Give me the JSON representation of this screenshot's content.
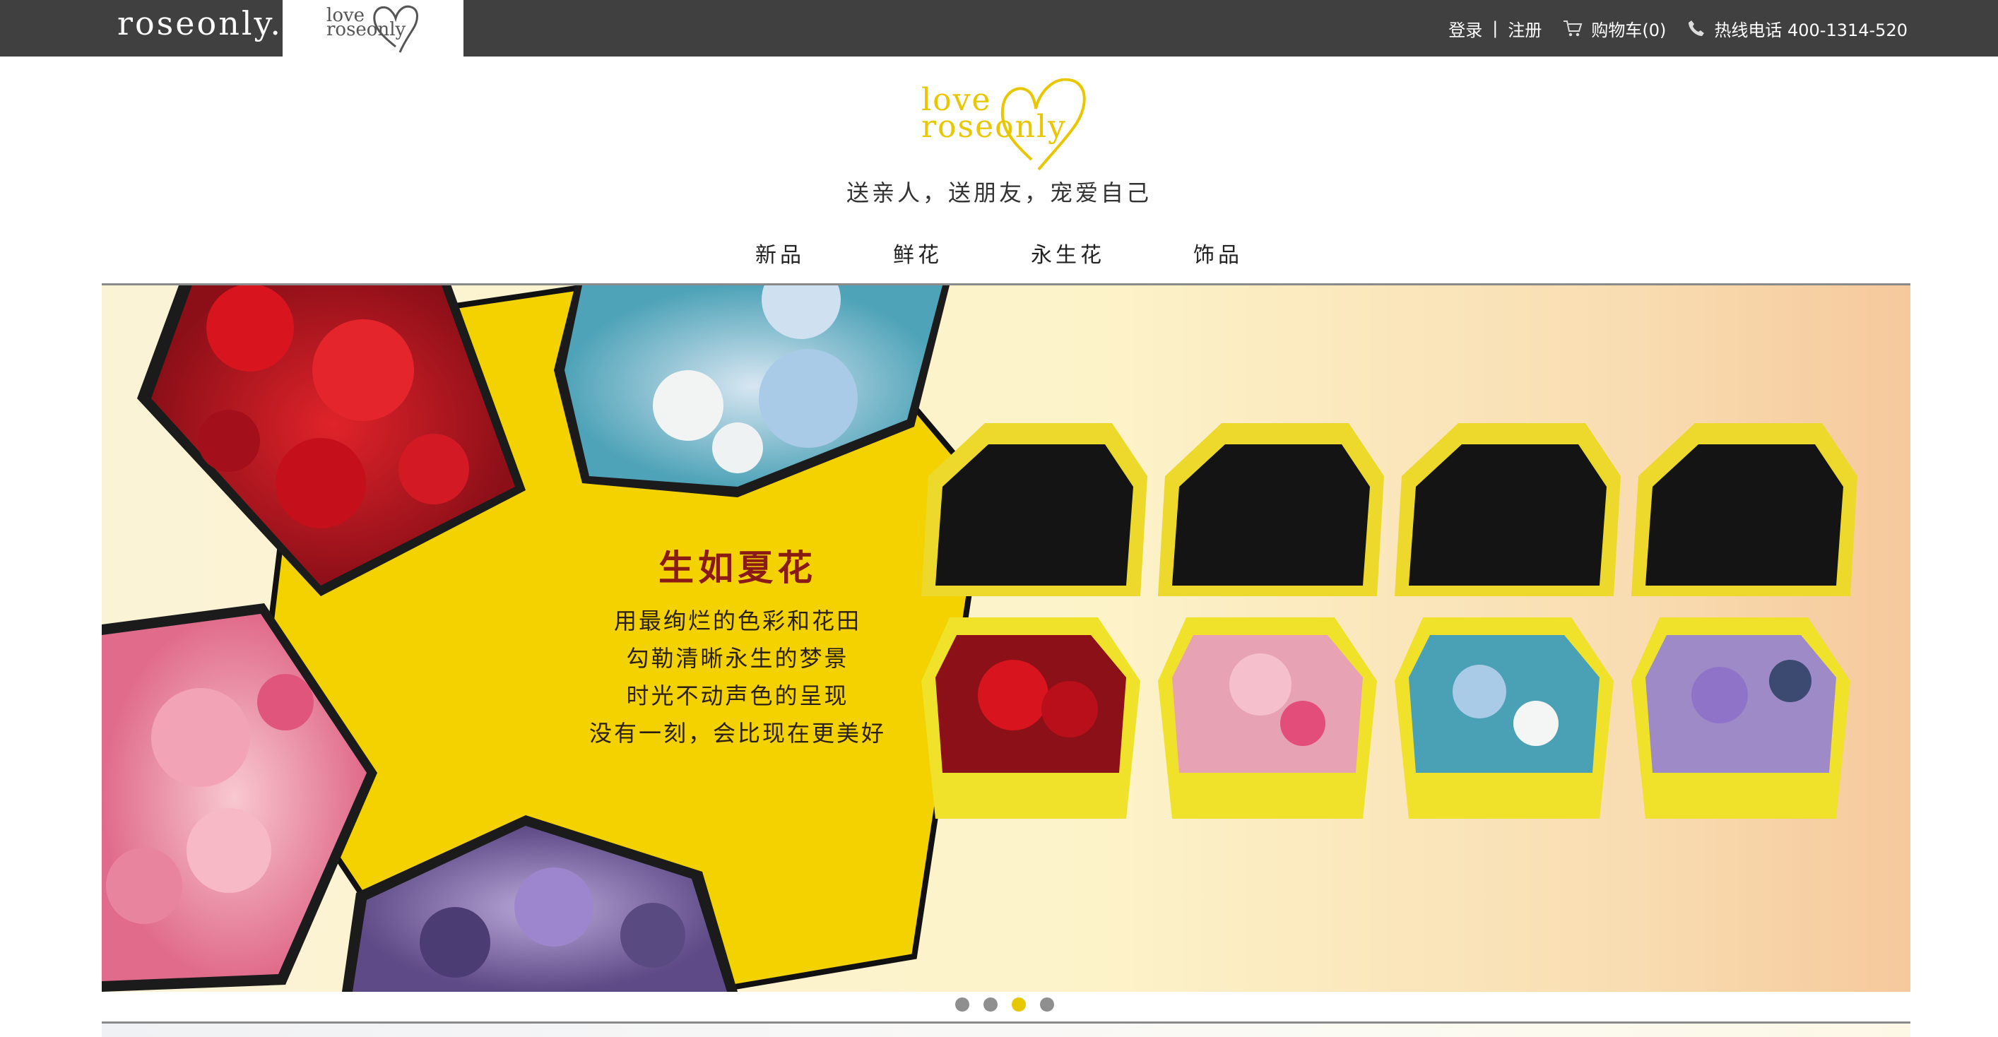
{
  "topbar": {
    "brand_tab": "roseonly.",
    "love_tab_line1": "love",
    "love_tab_line2": "roseonly",
    "login": "登录",
    "separator": "|",
    "register": "注册",
    "cart": "购物车(0)",
    "hotline": "热线电话 400-1314-520",
    "cart_icon": "cart-icon",
    "phone_icon": "phone-icon"
  },
  "logo": {
    "line1": "love",
    "line2": "roseonly",
    "tagline": "送亲人，送朋友，宠爱自己"
  },
  "nav": {
    "items": [
      "新品",
      "鲜花",
      "永生花",
      "饰品"
    ]
  },
  "hero": {
    "title": "生如夏花",
    "lines": [
      "用最绚烂的色彩和花田",
      "勾勒清晰永生的梦景",
      "时光不动声色的呈现",
      "没有一刻，会比现在更美好"
    ],
    "accent_yellow": "#f3d200",
    "box_yellow": "#f0e12a"
  },
  "carousel": {
    "count": 4,
    "active_index": 2
  },
  "colors": {
    "topbar_bg": "#404040",
    "logo_gold": "#e8c600",
    "hero_title": "#8a1a14",
    "dot_active": "#e6c800",
    "dot_inactive": "#8f8f8f"
  }
}
